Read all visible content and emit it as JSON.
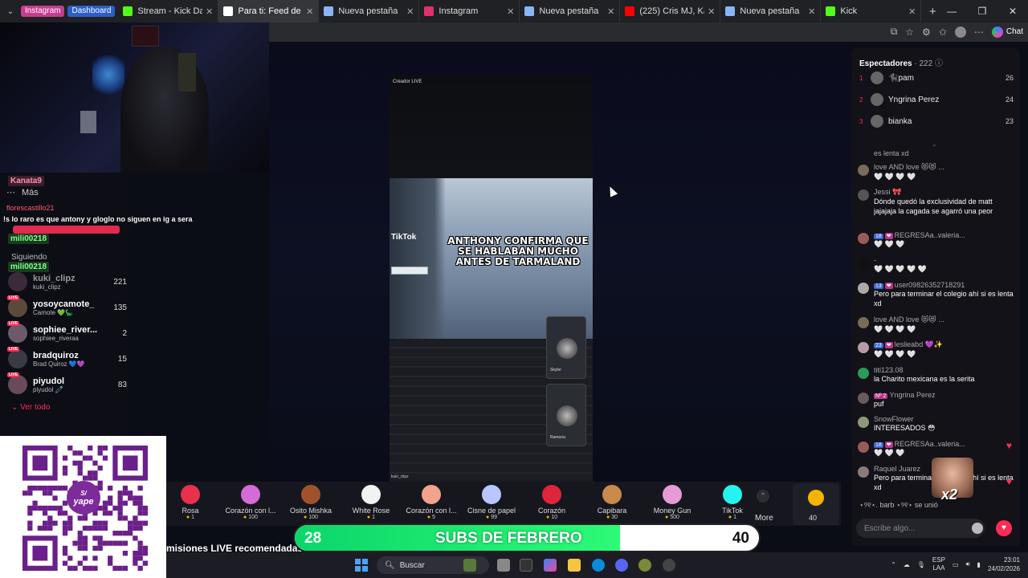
{
  "browser": {
    "pinned": [
      {
        "label": "Instagram"
      },
      {
        "label": "Dashboard"
      }
    ],
    "tabs": [
      {
        "label": "Stream - Kick Dashboard",
        "icon": "kick-icon",
        "color": "#53fc18",
        "active": false
      },
      {
        "label": "Para ti: Feed de TikTok",
        "icon": "tiktok-icon",
        "color": "#ffffff",
        "active": true
      },
      {
        "label": "Nueva pestaña",
        "icon": "newtab-icon",
        "color": "#8ab4f8",
        "active": false
      },
      {
        "label": "Instagram",
        "icon": "instagram-icon",
        "color": "#e1306c",
        "active": false
      },
      {
        "label": "Nueva pestaña",
        "icon": "newtab-icon",
        "color": "#8ab4f8",
        "active": false
      },
      {
        "label": "(225) Cris MJ, Kali Uchis",
        "icon": "youtube-icon",
        "color": "#ff0000",
        "active": false
      },
      {
        "label": "Nueva pestaña",
        "icon": "newtab-icon",
        "color": "#8ab4f8",
        "active": false
      },
      {
        "label": "Kick",
        "icon": "kick-icon",
        "color": "#53fc18",
        "active": false
      }
    ],
    "chat_button": "Chat"
  },
  "left": {
    "chat_names": [
      "Kanata9",
      "mili00218",
      "mili00218"
    ],
    "more_label": "Más",
    "flores": "florescastillo21",
    "chat_message": "!s lo raro es que antony y gloglo no siguen en ig a sera",
    "following_label": "Siguiendo",
    "users": [
      {
        "name": "kuki_clipz",
        "sub": "kuki_clipz",
        "count": "221"
      },
      {
        "name": "yosoycamote_",
        "sub": "Camote 💚🦕",
        "count": "135"
      },
      {
        "name": "sophiee_river...",
        "sub": "sophiee_riveraa",
        "count": "2"
      },
      {
        "name": "bradquiroz",
        "sub": "Brad Quiroz 💙💜",
        "count": "15"
      },
      {
        "name": "piyudol",
        "sub": "piyudol 🧷",
        "count": "83"
      }
    ],
    "see_all": "Ver todo"
  },
  "qr": {
    "brand": "yape"
  },
  "video": {
    "creator_label": "Creador LIVE",
    "tiktok_label": "TikTok",
    "headline": "ANTHONY CONFIRMA QUE SE HABLABAN MUCHO ANTES DE TARMALAND",
    "guests": [
      {
        "name": "Skyler"
      },
      {
        "name": "Ramona"
      }
    ],
    "bottom_tag": "kuki_clipz"
  },
  "gifts": [
    {
      "name": "Rosa",
      "price": "1",
      "color": "#e8304f"
    },
    {
      "name": "Corazón con l...",
      "price": "100",
      "color": "#d46bd6"
    },
    {
      "name": "Osito Mishka",
      "price": "100",
      "color": "#a0522d"
    },
    {
      "name": "White Rose",
      "price": "1",
      "color": "#f2f2f2"
    },
    {
      "name": "Corazón con l...",
      "price": "5",
      "color": "#f1a38b"
    },
    {
      "name": "Cisne de papel",
      "price": "99",
      "color": "#b9c6ff"
    },
    {
      "name": "Corazón",
      "price": "10",
      "color": "#e0243a"
    },
    {
      "name": "Capibara",
      "price": "30",
      "color": "#c98a4b"
    },
    {
      "name": "Money Gun",
      "price": "500",
      "color": "#e49bd6"
    },
    {
      "name": "TikTok",
      "price": "1",
      "color": "#25f4ee"
    }
  ],
  "gift_more": "More",
  "coins": "40",
  "subs": {
    "current": "28",
    "title": "SUBS DE FEBRERO",
    "goal": "40",
    "progress": 0.7
  },
  "recommended": "misiones LIVE recomendadas",
  "viewers": {
    "title": "Espectadores",
    "count": "· 222",
    "top": [
      {
        "rank": "1",
        "name": "🐈‍⬛pam",
        "value": "26"
      },
      {
        "rank": "2",
        "name": "Yngrina Perez",
        "value": "24"
      },
      {
        "rank": "3",
        "name": "bianka",
        "value": "23"
      }
    ],
    "partial": "es lenta xd",
    "messages": [
      {
        "name": "love AND love 😻😻 ...",
        "text": "🤍 🤍 🤍 🤍",
        "badges": []
      },
      {
        "name": "Jessi 🎀",
        "text": "Dónde quedó la exclusividad de matt jajajaja la cagada se agarró una peor",
        "badges": []
      },
      {
        "name": "REGRESAa..valeria...",
        "text": "🤍 🤍 🤍",
        "badges": [
          "18",
          "❤"
        ]
      },
      {
        "name": "-",
        "text": "🤍 🤍 🤍 🤍 🤍",
        "badges": []
      },
      {
        "name": "user09826352718291",
        "text": "Pero para terminar el colegio ahí si es lenta xd",
        "badges": [
          "13",
          "❤"
        ]
      },
      {
        "name": "love AND love 😻😻 ...",
        "text": "🤍 🤍 🤍 🤍",
        "badges": []
      },
      {
        "name": "leslieabd 💜✨",
        "text": "🤍 🤍 🤍 🤍",
        "badges": [
          "23",
          "❤"
        ]
      },
      {
        "name": "titi123.08",
        "text": "la Charito mexicana es la serita",
        "badges": []
      },
      {
        "name": "Yngrina Perez",
        "text": "puf",
        "badges": [
          "Nº 2"
        ]
      },
      {
        "name": "SnowFlower",
        "text": "INTERESADOS 😳",
        "badges": []
      },
      {
        "name": "REGRESAa..valeria...",
        "text": "🤍 🤍 🤍",
        "badges": [
          "18",
          "❤"
        ]
      },
      {
        "name": "Raquel Juarez",
        "text": "Pero para terminar el colegio ahí si es lenta xd",
        "badges": []
      }
    ],
    "joined": "⋆୨୧⋆. barb ⋆୨୧⋆ se unió",
    "input_placeholder": "Escribe algo..."
  },
  "taskbar": {
    "search": "Buscar",
    "lang_top": "ESP",
    "lang_bottom": "LAA",
    "time": "23:01",
    "date": "24/02/2026"
  }
}
